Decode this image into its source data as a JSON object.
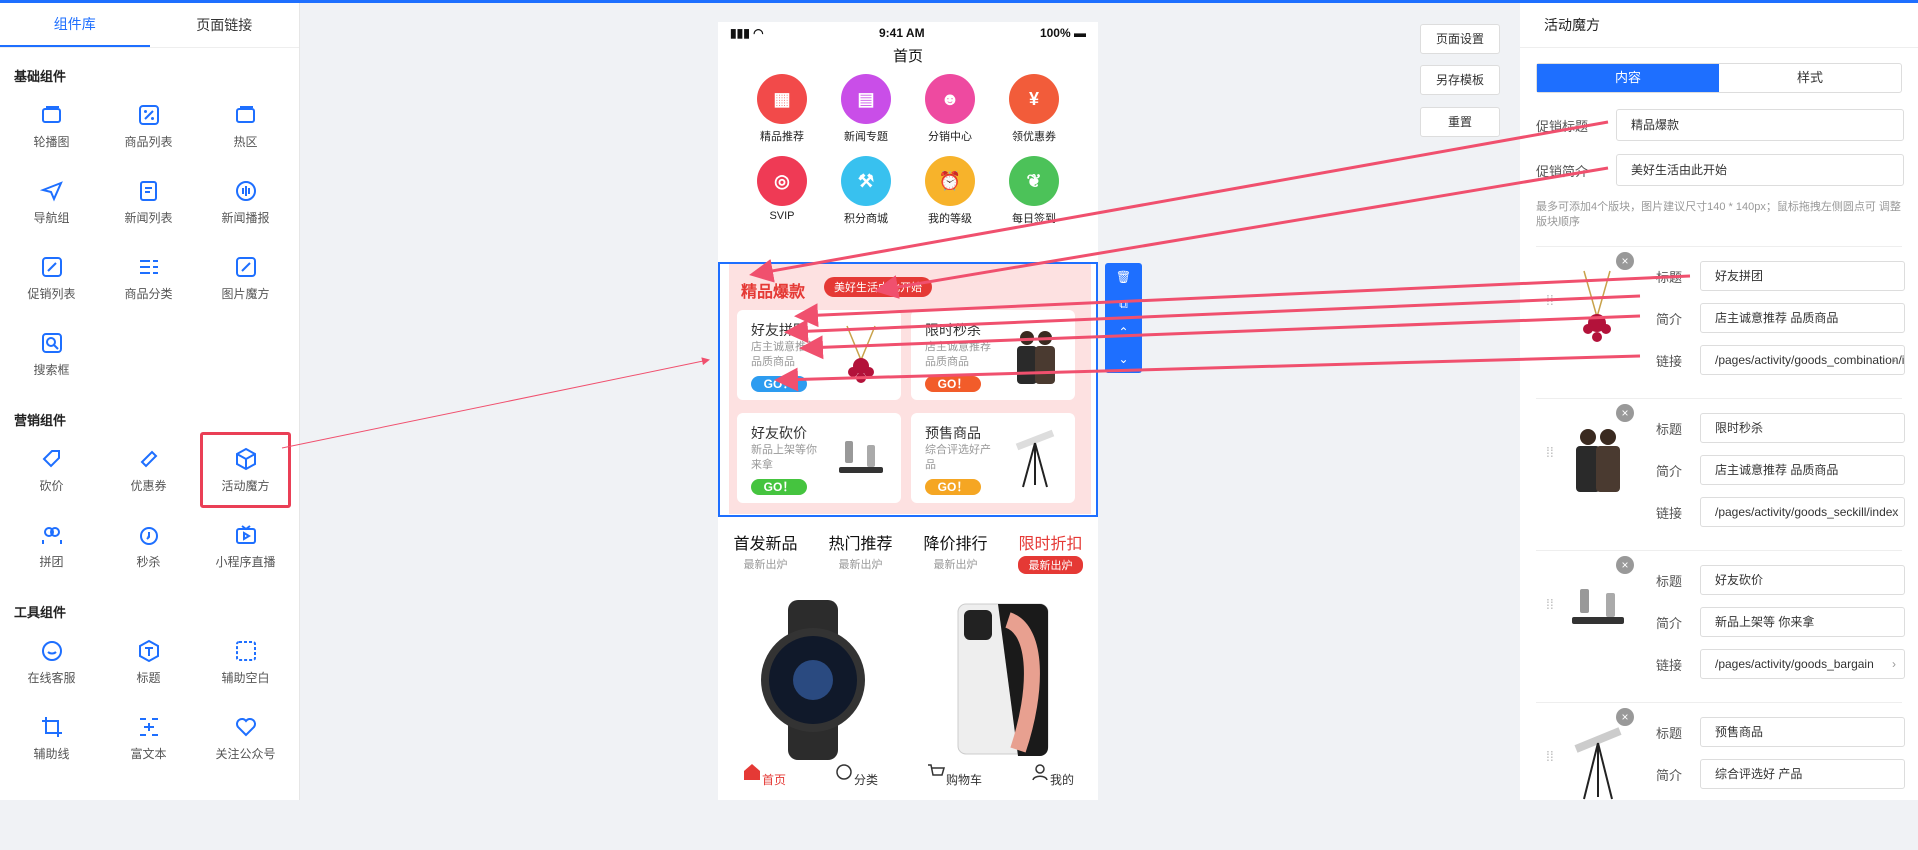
{
  "left": {
    "tabs": [
      "组件库",
      "页面链接"
    ],
    "sections": [
      {
        "title": "基础组件",
        "items": [
          "轮播图",
          "商品列表",
          "热区",
          "导航组",
          "新闻列表",
          "新闻播报",
          "促销列表",
          "商品分类",
          "图片魔方",
          "搜索框"
        ]
      },
      {
        "title": "营销组件",
        "items": [
          "砍价",
          "优惠券",
          "活动魔方",
          "拼团",
          "秒杀",
          "小程序直播"
        ]
      },
      {
        "title": "工具组件",
        "items": [
          "在线客服",
          "标题",
          "辅助空白",
          "辅助线",
          "富文本",
          "关注公众号"
        ]
      }
    ]
  },
  "phone": {
    "time": "9:41 AM",
    "battery": "100%",
    "title": "首页",
    "nav": [
      "精品推荐",
      "新闻专题",
      "分销中心",
      "领优惠券",
      "SVIP",
      "积分商城",
      "我的等级",
      "每日签到"
    ],
    "magic": {
      "title": "精品爆款",
      "pill": "美好生活由此开始",
      "cards": [
        {
          "title": "好友拼团",
          "desc": "店主诚意推荐 品质商品",
          "go": "GO！"
        },
        {
          "title": "限时秒杀",
          "desc": "店主诚意推荐 品质商品",
          "go": "GO！"
        },
        {
          "title": "好友砍价",
          "desc": "新品上架等你来拿",
          "go": "GO！"
        },
        {
          "title": "预售商品",
          "desc": "综合评选好产品",
          "go": "GO！"
        }
      ]
    },
    "tabs": [
      {
        "a": "首发新品",
        "b": "最新出炉"
      },
      {
        "a": "热门推荐",
        "b": "最新出炉"
      },
      {
        "a": "降价排行",
        "b": "最新出炉"
      },
      {
        "a": "限时折扣",
        "b": "最新出炉"
      }
    ],
    "bottom": [
      "首页",
      "分类",
      "购物车",
      "我的"
    ]
  },
  "buttons": [
    "页面设置",
    "另存模板",
    "重置"
  ],
  "right": {
    "title": "活动魔方",
    "seg": [
      "内容",
      "样式"
    ],
    "promo_title_label": "促销标题",
    "promo_title": "精品爆款",
    "promo_desc_label": "促销简介",
    "promo_desc": "美好生活由此开始",
    "hint": "最多可添加4个版块，图片建议尺寸140 * 140px；鼠标拖拽左侧圆点可 调整版块顺序",
    "labels": {
      "title": "标题",
      "desc": "简介",
      "link": "链接"
    },
    "blocks": [
      {
        "title": "好友拼团",
        "desc": "店主诚意推荐 品质商品",
        "link": "/pages/activity/goods_combination/index"
      },
      {
        "title": "限时秒杀",
        "desc": "店主诚意推荐 品质商品",
        "link": "/pages/activity/goods_seckill/index"
      },
      {
        "title": "好友砍价",
        "desc": "新品上架等 你来拿",
        "link": "/pages/activity/goods_bargain"
      },
      {
        "title": "预售商品",
        "desc": "综合评选好 产品",
        "link": ""
      }
    ]
  }
}
